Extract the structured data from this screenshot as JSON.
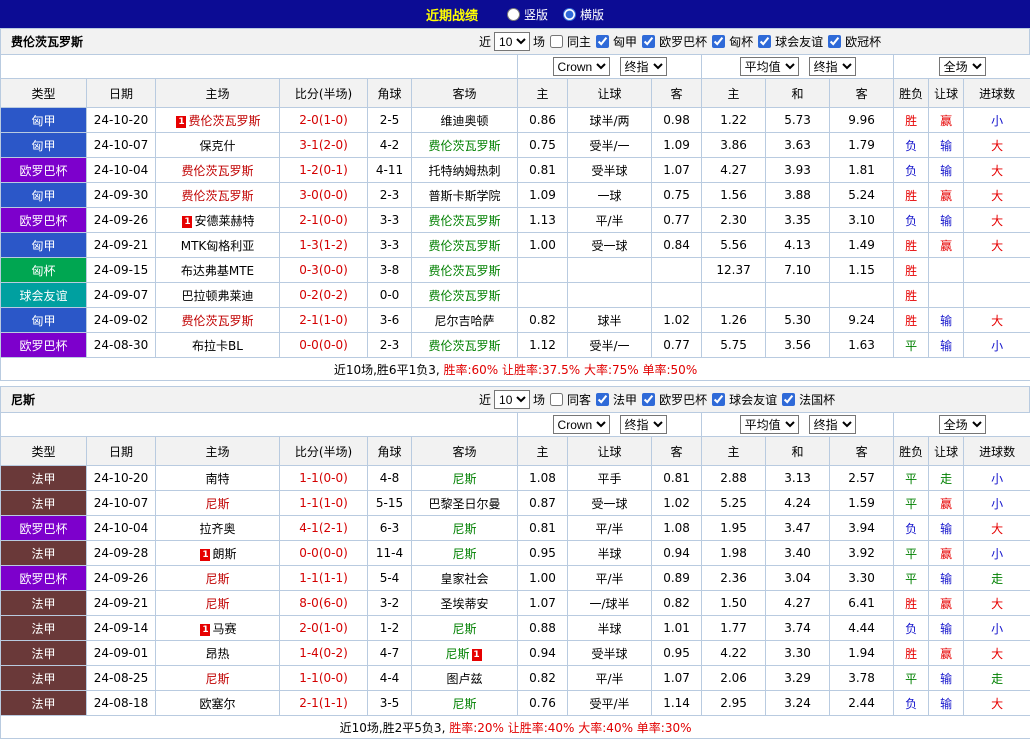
{
  "topbar": {
    "title": "近期战绩",
    "radio_vertical": "竖版",
    "radio_horizontal": "横版"
  },
  "columns": [
    "类型",
    "日期",
    "主场",
    "比分(半场)",
    "角球",
    "客场",
    "主",
    "让球",
    "客",
    "主",
    "和",
    "客",
    "胜负",
    "让球",
    "进球数"
  ],
  "league_colors": {
    "匈甲": "#2b57c8",
    "欧罗巴杯": "#7d00cc",
    "匈杯": "#00a651",
    "球会友谊": "#00a0a0",
    "法甲": "#6a3939"
  },
  "result_colors": {
    "r": "#e60000",
    "b": "#1414cc",
    "g": "#008000"
  },
  "sections": [
    {
      "team": "费伦茨瓦罗斯",
      "filter": {
        "near_label": "近",
        "count": "10",
        "games_label": "场",
        "same_label": "同主",
        "leagues": [
          "匈甲",
          "欧罗巴杯",
          "匈杯",
          "球会友谊",
          "欧冠杯"
        ]
      },
      "selects": [
        "Crown",
        "终指",
        "平均值",
        "终指",
        "全场"
      ],
      "rows": [
        {
          "type": "匈甲",
          "date": "24-10-20",
          "home": "费伦茨瓦罗斯",
          "home_cls": "self-home",
          "home_card": "1",
          "score": "2-0(1-0)",
          "corner": "2-5",
          "away": "维迪奥顿",
          "away_cls": "",
          "away_card": "",
          "odds": [
            "0.86",
            "球半/两",
            "0.98"
          ],
          "avg": [
            "1.22",
            "5.73",
            "9.96"
          ],
          "res": [
            [
              "胜",
              "r"
            ],
            [
              "赢",
              "r"
            ],
            [
              "小",
              "b"
            ]
          ]
        },
        {
          "type": "匈甲",
          "date": "24-10-07",
          "home": "保克什",
          "home_cls": "",
          "home_card": "",
          "score": "3-1(2-0)",
          "corner": "4-2",
          "away": "费伦茨瓦罗斯",
          "away_cls": "self-away",
          "away_card": "",
          "odds": [
            "0.75",
            "受半/一",
            "1.09"
          ],
          "avg": [
            "3.86",
            "3.63",
            "1.79"
          ],
          "res": [
            [
              "负",
              "b"
            ],
            [
              "输",
              "b"
            ],
            [
              "大",
              "r"
            ]
          ]
        },
        {
          "type": "欧罗巴杯",
          "date": "24-10-04",
          "home": "费伦茨瓦罗斯",
          "home_cls": "self-home",
          "home_card": "",
          "score": "1-2(0-1)",
          "corner": "4-11",
          "away": "托特纳姆热刺",
          "away_cls": "",
          "away_card": "",
          "odds": [
            "0.81",
            "受半球",
            "1.07"
          ],
          "avg": [
            "4.27",
            "3.93",
            "1.81"
          ],
          "res": [
            [
              "负",
              "b"
            ],
            [
              "输",
              "b"
            ],
            [
              "大",
              "r"
            ]
          ]
        },
        {
          "type": "匈甲",
          "date": "24-09-30",
          "home": "费伦茨瓦罗斯",
          "home_cls": "self-home",
          "home_card": "",
          "score": "3-0(0-0)",
          "corner": "2-3",
          "away": "普斯卡斯学院",
          "away_cls": "",
          "away_card": "",
          "odds": [
            "1.09",
            "一球",
            "0.75"
          ],
          "avg": [
            "1.56",
            "3.88",
            "5.24"
          ],
          "res": [
            [
              "胜",
              "r"
            ],
            [
              "赢",
              "r"
            ],
            [
              "大",
              "r"
            ]
          ]
        },
        {
          "type": "欧罗巴杯",
          "date": "24-09-26",
          "home": "安德莱赫特",
          "home_cls": "",
          "home_card": "1",
          "score": "2-1(0-0)",
          "corner": "3-3",
          "away": "费伦茨瓦罗斯",
          "away_cls": "self-away",
          "away_card": "",
          "odds": [
            "1.13",
            "平/半",
            "0.77"
          ],
          "avg": [
            "2.30",
            "3.35",
            "3.10"
          ],
          "res": [
            [
              "负",
              "b"
            ],
            [
              "输",
              "b"
            ],
            [
              "大",
              "r"
            ]
          ]
        },
        {
          "type": "匈甲",
          "date": "24-09-21",
          "home": "MTK匈格利亚",
          "home_cls": "",
          "home_card": "",
          "score": "1-3(1-2)",
          "corner": "3-3",
          "away": "费伦茨瓦罗斯",
          "away_cls": "self-away",
          "away_card": "",
          "odds": [
            "1.00",
            "受一球",
            "0.84"
          ],
          "avg": [
            "5.56",
            "4.13",
            "1.49"
          ],
          "res": [
            [
              "胜",
              "r"
            ],
            [
              "赢",
              "r"
            ],
            [
              "大",
              "r"
            ]
          ]
        },
        {
          "type": "匈杯",
          "date": "24-09-15",
          "home": "布达弗基MTE",
          "home_cls": "",
          "home_card": "",
          "score": "0-3(0-0)",
          "corner": "3-8",
          "away": "费伦茨瓦罗斯",
          "away_cls": "self-away",
          "away_card": "",
          "odds": [
            "",
            "",
            ""
          ],
          "avg": [
            "12.37",
            "7.10",
            "1.15"
          ],
          "res": [
            [
              "胜",
              "r"
            ],
            [
              "",
              ""
            ],
            [
              "",
              ""
            ]
          ]
        },
        {
          "type": "球会友谊",
          "date": "24-09-07",
          "home": "巴拉顿弗莱迪",
          "home_cls": "",
          "home_card": "",
          "score": "0-2(0-2)",
          "corner": "0-0",
          "away": "费伦茨瓦罗斯",
          "away_cls": "self-away",
          "away_card": "",
          "odds": [
            "",
            "",
            ""
          ],
          "avg": [
            "",
            "",
            ""
          ],
          "res": [
            [
              "胜",
              "r"
            ],
            [
              "",
              ""
            ],
            [
              "",
              ""
            ]
          ]
        },
        {
          "type": "匈甲",
          "date": "24-09-02",
          "home": "费伦茨瓦罗斯",
          "home_cls": "self-home",
          "home_card": "",
          "score": "2-1(1-0)",
          "corner": "3-6",
          "away": "尼尔吉哈萨",
          "away_cls": "",
          "away_card": "",
          "odds": [
            "0.82",
            "球半",
            "1.02"
          ],
          "avg": [
            "1.26",
            "5.30",
            "9.24"
          ],
          "res": [
            [
              "胜",
              "r"
            ],
            [
              "输",
              "b"
            ],
            [
              "大",
              "r"
            ]
          ]
        },
        {
          "type": "欧罗巴杯",
          "date": "24-08-30",
          "home": "布拉卡BL",
          "home_cls": "",
          "home_card": "",
          "score": "0-0(0-0)",
          "corner": "2-3",
          "away": "费伦茨瓦罗斯",
          "away_cls": "self-away",
          "away_card": "",
          "odds": [
            "1.12",
            "受半/一",
            "0.77"
          ],
          "avg": [
            "5.75",
            "3.56",
            "1.63"
          ],
          "res": [
            [
              "平",
              "g"
            ],
            [
              "输",
              "b"
            ],
            [
              "小",
              "b"
            ]
          ]
        }
      ],
      "summary_prefix": "近10场,胜6平1负3, ",
      "summary_stats": "胜率:60% 让胜率:37.5% 大率:75% 单率:50%"
    },
    {
      "team": "尼斯",
      "filter": {
        "near_label": "近",
        "count": "10",
        "games_label": "场",
        "same_label": "同客",
        "leagues": [
          "法甲",
          "欧罗巴杯",
          "球会友谊",
          "法国杯"
        ]
      },
      "selects": [
        "Crown",
        "终指",
        "平均值",
        "终指",
        "全场"
      ],
      "rows": [
        {
          "type": "法甲",
          "date": "24-10-20",
          "home": "南特",
          "home_cls": "",
          "home_card": "",
          "score": "1-1(0-0)",
          "corner": "4-8",
          "away": "尼斯",
          "away_cls": "self-away",
          "away_card": "",
          "odds": [
            "1.08",
            "平手",
            "0.81"
          ],
          "avg": [
            "2.88",
            "3.13",
            "2.57"
          ],
          "res": [
            [
              "平",
              "g"
            ],
            [
              "走",
              "g"
            ],
            [
              "小",
              "b"
            ]
          ]
        },
        {
          "type": "法甲",
          "date": "24-10-07",
          "home": "尼斯",
          "home_cls": "self-home",
          "home_card": "",
          "score": "1-1(1-0)",
          "corner": "5-15",
          "away": "巴黎圣日尔曼",
          "away_cls": "",
          "away_card": "",
          "odds": [
            "0.87",
            "受一球",
            "1.02"
          ],
          "avg": [
            "5.25",
            "4.24",
            "1.59"
          ],
          "res": [
            [
              "平",
              "g"
            ],
            [
              "赢",
              "r"
            ],
            [
              "小",
              "b"
            ]
          ]
        },
        {
          "type": "欧罗巴杯",
          "date": "24-10-04",
          "home": "拉齐奥",
          "home_cls": "",
          "home_card": "",
          "score": "4-1(2-1)",
          "corner": "6-3",
          "away": "尼斯",
          "away_cls": "self-away",
          "away_card": "",
          "odds": [
            "0.81",
            "平/半",
            "1.08"
          ],
          "avg": [
            "1.95",
            "3.47",
            "3.94"
          ],
          "res": [
            [
              "负",
              "b"
            ],
            [
              "输",
              "b"
            ],
            [
              "大",
              "r"
            ]
          ]
        },
        {
          "type": "法甲",
          "date": "24-09-28",
          "home": "朗斯",
          "home_cls": "",
          "home_card": "1",
          "score": "0-0(0-0)",
          "corner": "11-4",
          "away": "尼斯",
          "away_cls": "self-away",
          "away_card": "",
          "odds": [
            "0.95",
            "半球",
            "0.94"
          ],
          "avg": [
            "1.98",
            "3.40",
            "3.92"
          ],
          "res": [
            [
              "平",
              "g"
            ],
            [
              "赢",
              "r"
            ],
            [
              "小",
              "b"
            ]
          ]
        },
        {
          "type": "欧罗巴杯",
          "date": "24-09-26",
          "home": "尼斯",
          "home_cls": "self-home",
          "home_card": "",
          "score": "1-1(1-1)",
          "corner": "5-4",
          "away": "皇家社会",
          "away_cls": "",
          "away_card": "",
          "odds": [
            "1.00",
            "平/半",
            "0.89"
          ],
          "avg": [
            "2.36",
            "3.04",
            "3.30"
          ],
          "res": [
            [
              "平",
              "g"
            ],
            [
              "输",
              "b"
            ],
            [
              "走",
              "g"
            ]
          ]
        },
        {
          "type": "法甲",
          "date": "24-09-21",
          "home": "尼斯",
          "home_cls": "self-home",
          "home_card": "",
          "score": "8-0(6-0)",
          "corner": "3-2",
          "away": "圣埃蒂安",
          "away_cls": "",
          "away_card": "",
          "odds": [
            "1.07",
            "一/球半",
            "0.82"
          ],
          "avg": [
            "1.50",
            "4.27",
            "6.41"
          ],
          "res": [
            [
              "胜",
              "r"
            ],
            [
              "赢",
              "r"
            ],
            [
              "大",
              "r"
            ]
          ]
        },
        {
          "type": "法甲",
          "date": "24-09-14",
          "home": "马赛",
          "home_cls": "",
          "home_card": "1",
          "score": "2-0(1-0)",
          "corner": "1-2",
          "away": "尼斯",
          "away_cls": "self-away",
          "away_card": "",
          "odds": [
            "0.88",
            "半球",
            "1.01"
          ],
          "avg": [
            "1.77",
            "3.74",
            "4.44"
          ],
          "res": [
            [
              "负",
              "b"
            ],
            [
              "输",
              "b"
            ],
            [
              "小",
              "b"
            ]
          ]
        },
        {
          "type": "法甲",
          "date": "24-09-01",
          "home": "昂热",
          "home_cls": "",
          "home_card": "",
          "score": "1-4(0-2)",
          "corner": "4-7",
          "away": "尼斯",
          "away_cls": "self-away",
          "away_card": "1",
          "odds": [
            "0.94",
            "受半球",
            "0.95"
          ],
          "avg": [
            "4.22",
            "3.30",
            "1.94"
          ],
          "res": [
            [
              "胜",
              "r"
            ],
            [
              "赢",
              "r"
            ],
            [
              "大",
              "r"
            ]
          ]
        },
        {
          "type": "法甲",
          "date": "24-08-25",
          "home": "尼斯",
          "home_cls": "self-home",
          "home_card": "",
          "score": "1-1(0-0)",
          "corner": "4-4",
          "away": "图卢兹",
          "away_cls": "",
          "away_card": "",
          "odds": [
            "0.82",
            "平/半",
            "1.07"
          ],
          "avg": [
            "2.06",
            "3.29",
            "3.78"
          ],
          "res": [
            [
              "平",
              "g"
            ],
            [
              "输",
              "b"
            ],
            [
              "走",
              "g"
            ]
          ]
        },
        {
          "type": "法甲",
          "date": "24-08-18",
          "home": "欧塞尔",
          "home_cls": "",
          "home_card": "",
          "score": "2-1(1-1)",
          "corner": "3-5",
          "away": "尼斯",
          "away_cls": "self-away",
          "away_card": "",
          "odds": [
            "0.76",
            "受平/半",
            "1.14"
          ],
          "avg": [
            "2.95",
            "3.24",
            "2.44"
          ],
          "res": [
            [
              "负",
              "b"
            ],
            [
              "输",
              "b"
            ],
            [
              "大",
              "r"
            ]
          ]
        }
      ],
      "summary_prefix": "近10场,胜2平5负3, ",
      "summary_stats": "胜率:20% 让胜率:40% 大率:40% 单率:30%"
    }
  ]
}
